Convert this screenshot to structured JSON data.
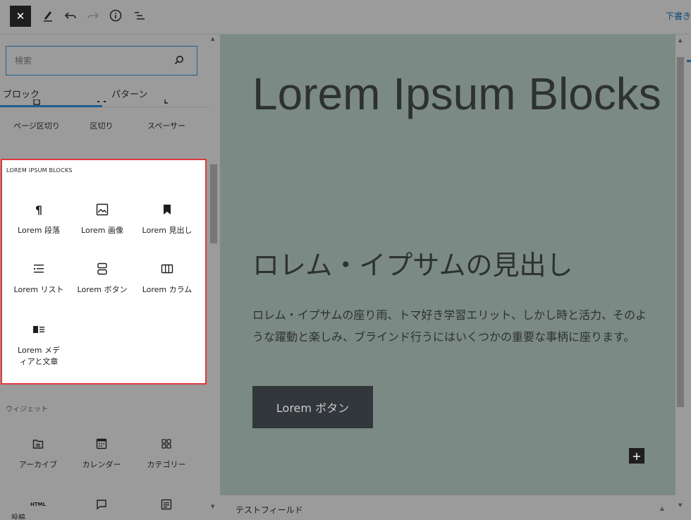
{
  "toolbar": {
    "close_glyph": "✕",
    "draft_label": "下書き"
  },
  "sidebar": {
    "search_placeholder": "検索",
    "tabs": {
      "blocks": "ブロック",
      "patterns": "パターン"
    },
    "top_blocks": [
      {
        "label": "ページ区切り",
        "icon": "page-break-icon"
      },
      {
        "label": "区切り",
        "icon": "separator-icon"
      },
      {
        "label": "スペーサー",
        "icon": "spacer-icon"
      }
    ],
    "custom_category": {
      "title": "LOREM IPSUM BLOCKS",
      "blocks": [
        {
          "label": "Lorem 段落",
          "icon": "paragraph-icon"
        },
        {
          "label": "Lorem 画像",
          "icon": "image-icon"
        },
        {
          "label": "Lorem 見出し",
          "icon": "bookmark-icon"
        },
        {
          "label": "Lorem リスト",
          "icon": "list-icon"
        },
        {
          "label": "Lorem ボタン",
          "icon": "button-icon"
        },
        {
          "label": "Lorem カラム",
          "icon": "columns-icon"
        },
        {
          "label": "Lorem メディアと文章",
          "icon": "media-text-icon"
        }
      ]
    },
    "widgets": {
      "title": "ウィジェット",
      "blocks": [
        {
          "label": "アーカイブ",
          "icon": "archive-icon"
        },
        {
          "label": "カレンダー",
          "icon": "calendar-icon"
        },
        {
          "label": "カテゴリー",
          "icon": "categories-icon"
        },
        {
          "label": "HTML",
          "icon": "html-icon"
        },
        {
          "label": "",
          "icon": "comment-icon"
        },
        {
          "label": "",
          "icon": "form-icon"
        }
      ]
    }
  },
  "canvas": {
    "title": "Lorem Ipsum Blocks",
    "subheading": "ロレム・イプサムの見出し",
    "paragraph": "ロレム・イプサムの座り雨、トマ好き学習エリット、しかし時と活力、そのような躍動と楽しみ、ブラインド行うにはいくつかの重要な事柄に座ります。",
    "button_label": "Lorem ボタン",
    "plus_glyph": "+"
  },
  "fieldbar": {
    "label": "テストフィールド"
  },
  "status": {
    "label": "投稿"
  },
  "colors": {
    "accent": "#1e5e8c",
    "highlight": "#e0393e",
    "canvas_bg": "#7b8a84"
  }
}
